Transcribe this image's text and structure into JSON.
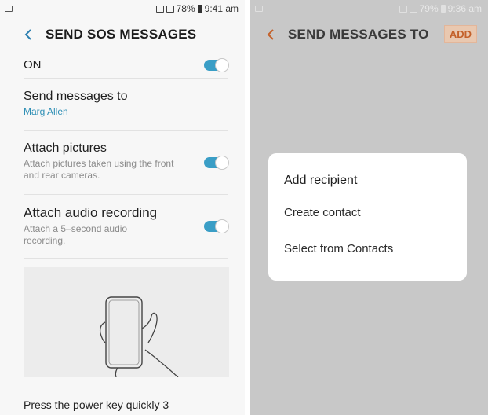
{
  "left_screen": {
    "status": {
      "battery": "78%",
      "time": "9:41 am"
    },
    "title": "SEND SOS MESSAGES",
    "master": {
      "label": "ON",
      "enabled": true
    },
    "send_to": {
      "title": "Send messages to",
      "value": "Marg Allen"
    },
    "attach_pictures": {
      "title": "Attach pictures",
      "subtitle": "Attach pictures taken using the front and rear cameras.",
      "enabled": true
    },
    "attach_audio": {
      "title": "Attach audio recording",
      "subtitle": "Attach a 5–second audio recording.",
      "enabled": true
    },
    "footer": "Press the power key quickly 3"
  },
  "right_screen": {
    "status": {
      "battery": "79%",
      "time": "9:36 am"
    },
    "title": "SEND MESSAGES TO",
    "add_label": "ADD",
    "dialog": {
      "title": "Add recipient",
      "options": [
        "Create contact",
        "Select from Contacts"
      ]
    }
  },
  "icons": [
    "back-icon",
    "toggle-switch",
    "hand-phone-illustration",
    "wifi-icon",
    "signal-icon",
    "battery-icon"
  ],
  "colors": {
    "accent_blue": "#3a9ec6",
    "link_blue": "#2e8fb5",
    "add_orange": "#c4612a"
  }
}
